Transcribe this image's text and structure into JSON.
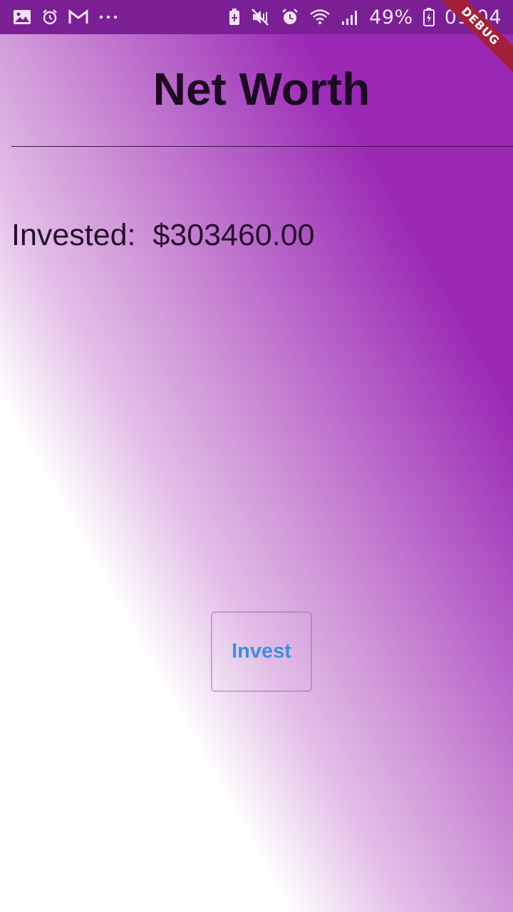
{
  "status_bar": {
    "left_icons": [
      "image-icon",
      "alarm-icon",
      "gmail-icon",
      "more-dots-icon"
    ],
    "right_icons": [
      "battery-saver-icon",
      "mute-icon",
      "alarm-clock-icon",
      "wifi-icon",
      "signal-icon"
    ],
    "battery_percent": "49%",
    "time": "01:04"
  },
  "debug_banner": {
    "label": "DEBUG"
  },
  "page": {
    "title": "Net Worth",
    "invested_label": "Invested:  $303460.00"
  },
  "actions": {
    "invest_label": "Invest"
  },
  "colors": {
    "status_bar": "#7b1f95",
    "gradient_top": "#9b27b5",
    "gradient_bottom": "#ffffff",
    "button_text": "#3d8fe0",
    "debug_ribbon": "#a3203a"
  }
}
